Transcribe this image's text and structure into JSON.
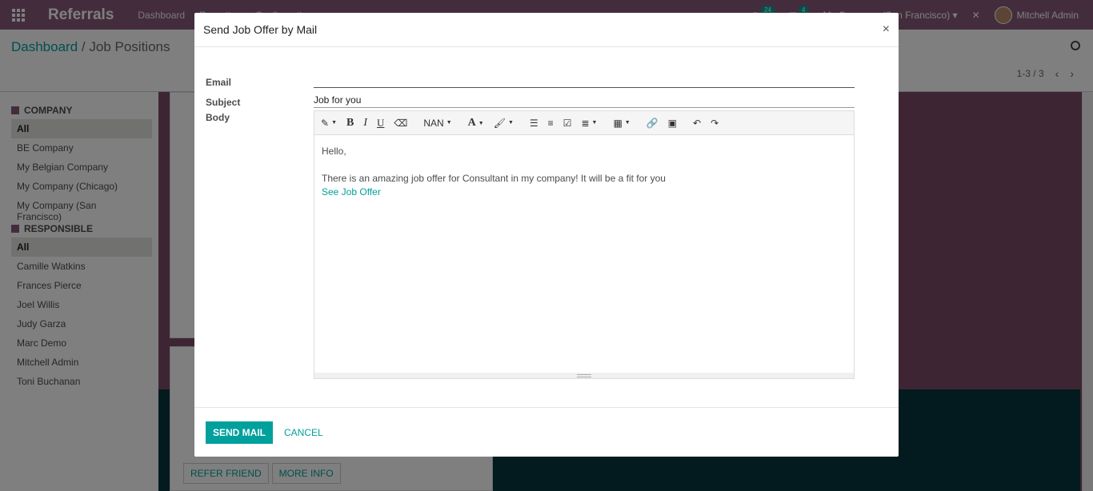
{
  "navbar": {
    "brand": "Referrals",
    "menus": [
      "Dashboard",
      "Reporting",
      "Configuration"
    ],
    "activity_count": "24",
    "message_count": "4",
    "company": "My Company (San Francisco)",
    "user": "Mitchell Admin"
  },
  "control": {
    "breadcrumb_root": "Dashboard",
    "breadcrumb_sep": "/",
    "breadcrumb_current": "Job Positions",
    "pager": "1-3 / 3"
  },
  "sidebar": {
    "company_header": "COMPANY",
    "companies": [
      "All",
      "BE Company",
      "My Belgian Company",
      "My Company (Chicago)",
      "My Company (San Francisco)"
    ],
    "responsible_header": "RESPONSIBLE",
    "responsibles": [
      "All",
      "Camille Watkins",
      "Frances Pierce",
      "Joel Willis",
      "Judy Garza",
      "Marc Demo",
      "Mitchell Admin",
      "Toni Buchanan"
    ]
  },
  "background": {
    "refer_friend": "REFER FRIEND",
    "more_info": "MORE INFO"
  },
  "dialog": {
    "title": "Send Job Offer by Mail",
    "close": "×",
    "email_label": "Email",
    "email_value": "",
    "subject_label": "Subject",
    "subject_value": "Job for you",
    "body_label": "Body",
    "toolbar": {
      "font_style": "NAN"
    },
    "body": {
      "greeting": "Hello,",
      "message": "There is an amazing job offer for Consultant in my company! It will be a fit for you",
      "link": "See Job Offer"
    },
    "send_button": "SEND MAIL",
    "cancel_button": "CANCEL"
  }
}
